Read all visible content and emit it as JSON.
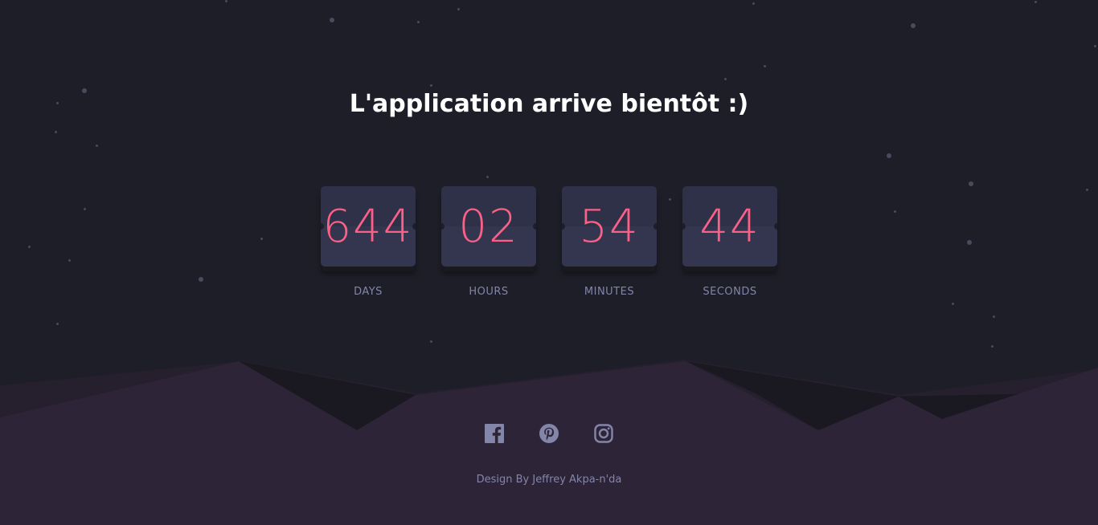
{
  "header": {
    "title": "L'application arrive bientôt :)"
  },
  "countdown": {
    "days": {
      "value": "644",
      "label": "DAYS"
    },
    "hours": {
      "value": "02",
      "label": "HOURS"
    },
    "minutes": {
      "value": "54",
      "label": "MINUTES"
    },
    "seconds": {
      "value": "44",
      "label": "SECONDS"
    }
  },
  "social": {
    "icons": [
      "facebook-icon",
      "pinterest-icon",
      "instagram-icon"
    ]
  },
  "footer": {
    "credit": "Design By Jeffrey Akpa-n'da"
  },
  "colors": {
    "background": "#1e1e28",
    "card": "#343650",
    "accent": "#fb6087",
    "muted": "#8385a9",
    "hills": "#2e2438"
  }
}
